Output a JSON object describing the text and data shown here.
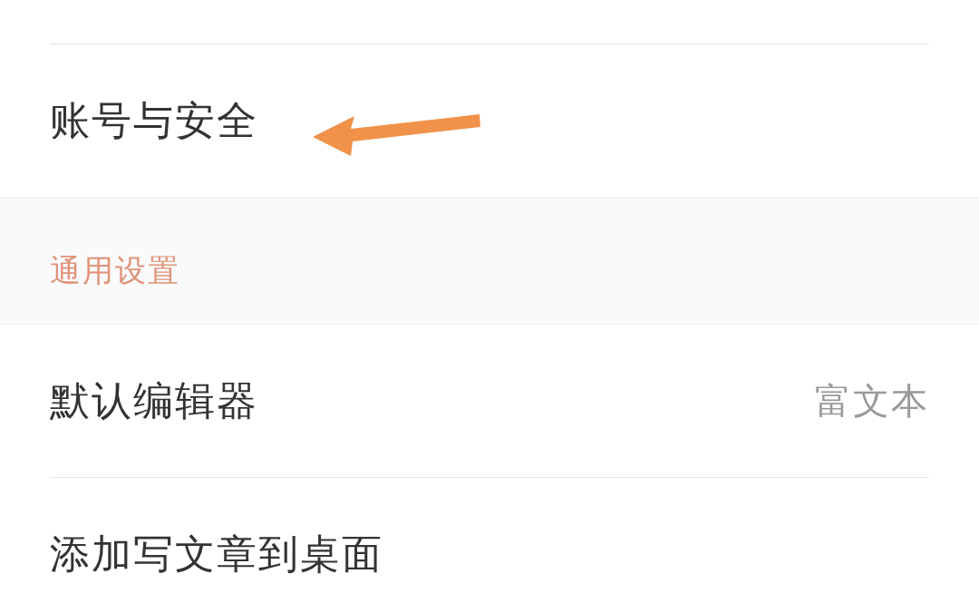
{
  "rows_top": [
    {
      "label": "账号与安全"
    }
  ],
  "section": {
    "title": "通用设置"
  },
  "rows": [
    {
      "label": "默认编辑器",
      "value": "富文本"
    },
    {
      "label": "添加写文章到桌面"
    }
  ]
}
